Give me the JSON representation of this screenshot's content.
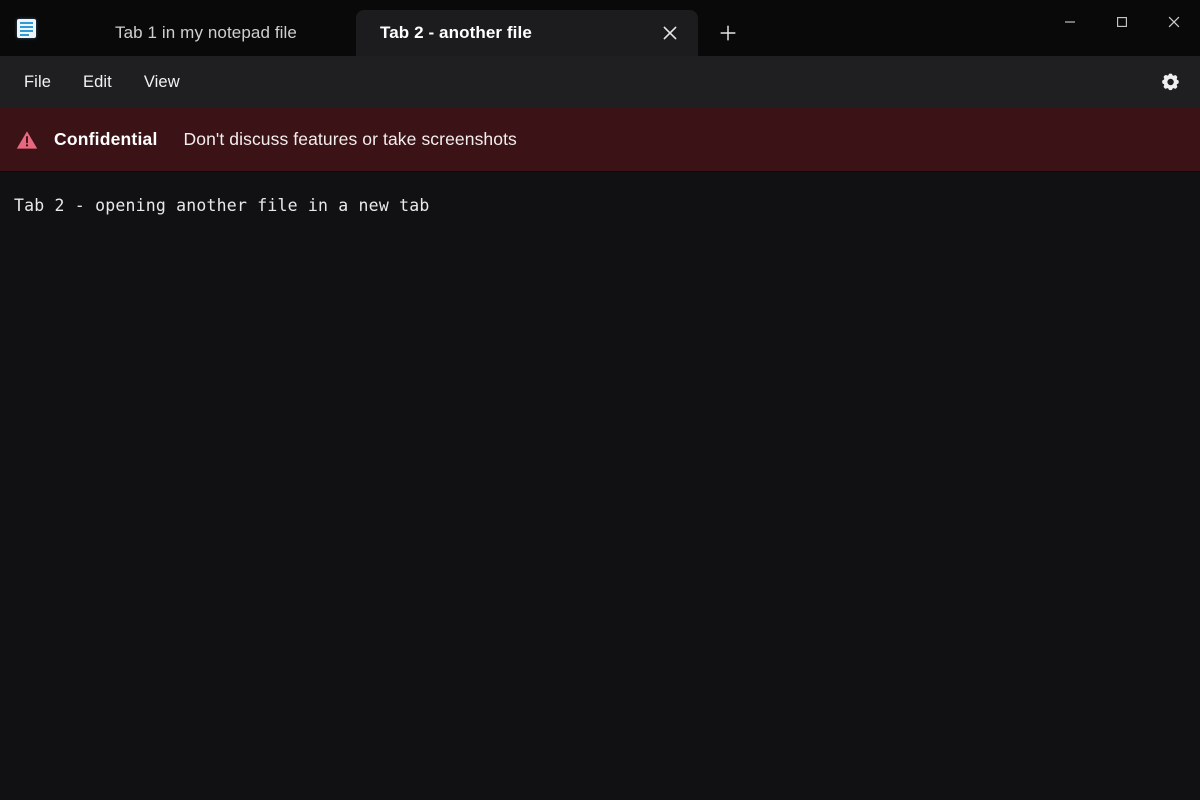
{
  "window": {
    "app_icon": "notepad-icon",
    "controls": {
      "minimize": "minimize-icon",
      "maximize": "maximize-icon",
      "close": "close-icon"
    }
  },
  "tabs": {
    "items": [
      {
        "label": "Tab 1 in my notepad file",
        "active": false
      },
      {
        "label": "Tab 2 - another file",
        "active": true
      }
    ],
    "new_tab_label": "+",
    "close_tab_icon": "close-icon"
  },
  "menubar": {
    "items": [
      {
        "label": "File"
      },
      {
        "label": "Edit"
      },
      {
        "label": "View"
      }
    ],
    "settings_icon": "gear-icon"
  },
  "banner": {
    "icon": "warning-triangle-icon",
    "title": "Confidential",
    "message": "Don't discuss features or take screenshots",
    "background_color": "#3b1216",
    "icon_color": "#e8697f"
  },
  "editor": {
    "content": "Tab 2 - opening another file in a new tab"
  }
}
